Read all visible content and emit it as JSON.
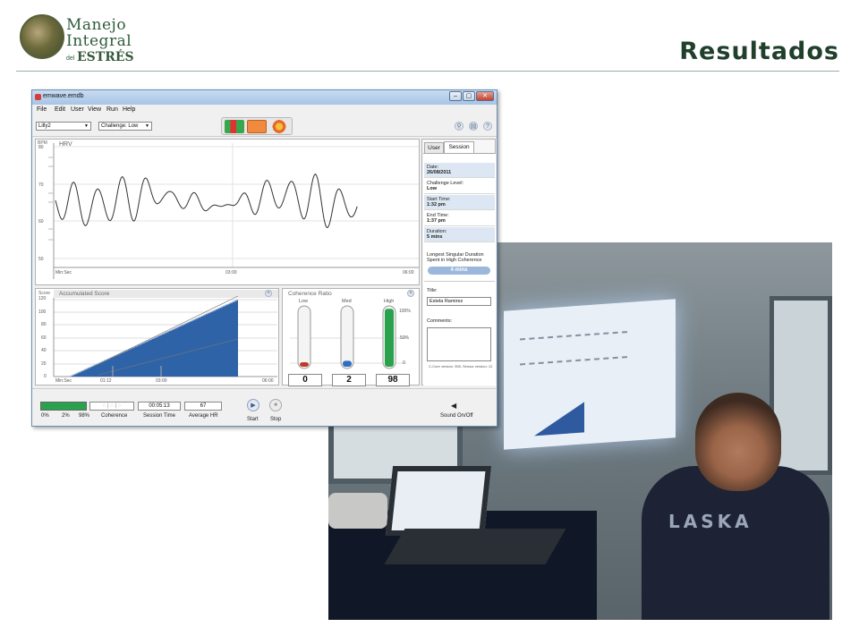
{
  "slide": {
    "title": "Resultados",
    "logo": {
      "line1": "Manejo",
      "line2": "Integral",
      "line3_small": "del",
      "line3": "ESTRÉS"
    }
  },
  "app": {
    "window_title": "emwave.emdb",
    "window_buttons": [
      "–",
      "▢",
      "✕"
    ],
    "menu": [
      "File",
      "Edit",
      "User",
      "View",
      "Run",
      "Help"
    ],
    "toolbar": {
      "user_select": "Lilly2",
      "challenge_select": "Challenge: Low",
      "icons": [
        "search-icon",
        "book-icon",
        "help-icon"
      ],
      "help_glyph": "?"
    },
    "hrv": {
      "title": "HRV",
      "y_unit": "BPM",
      "y_ticks": [
        "80",
        "70",
        "60",
        "50"
      ],
      "x_label": "Min:Sec",
      "x_ticks": [
        "03:00",
        "06:00"
      ]
    },
    "accumulated": {
      "title": "Accumulated Score",
      "y_label": "Score",
      "y_ticks": [
        "120",
        "100",
        "80",
        "60",
        "40",
        "20",
        "0"
      ],
      "x_label": "Min:Sec",
      "x_ticks": [
        "01:12",
        "03:00",
        "06:00"
      ]
    },
    "coherence": {
      "title": "Coherence Ratio",
      "labels": [
        "Low",
        "Med",
        "High"
      ],
      "percent_ticks": [
        "100%",
        "50%",
        "0"
      ],
      "values": [
        "0",
        "2",
        "98"
      ],
      "fills": [
        0.02,
        0.1,
        0.98
      ]
    },
    "side": {
      "tabs": [
        "User",
        "Session"
      ],
      "date_label": "Date:",
      "date_value": "26/08/2011",
      "challenge_label": "Challenge Level:",
      "challenge_value": "Low",
      "start_label": "Start Time:",
      "start_value": "1:32 pm",
      "end_label": "End Time:",
      "end_value": "1:37 pm",
      "duration_label": "Duration:",
      "duration_value": "5 mins",
      "longest_label": "Longest Singular Duration Spent in High Coherence",
      "longest_value": "4 mins",
      "title_label": "Title:",
      "title_value": "Estela Ramirez",
      "comments_label": "Comments:",
      "version": "C-Core version: 355, Sensor version: 12"
    },
    "bottom": {
      "ratio_low": "0%",
      "ratio_med": "2%",
      "ratio_high": "98%",
      "coherence_label": "Coherence",
      "session_time": "00:05:13",
      "session_time_label": "Session Time",
      "average_hr": "67",
      "average_hr_label": "Average HR",
      "start_label": "Start",
      "stop_label": "Stop",
      "sound_label": "Sound On/Off"
    }
  },
  "colors": {
    "title": "#20402c",
    "accent_green": "#2aa14c",
    "score_blue": "#2f63a8",
    "low_red": "#c0392b",
    "med_blue": "#2f6ec0"
  }
}
